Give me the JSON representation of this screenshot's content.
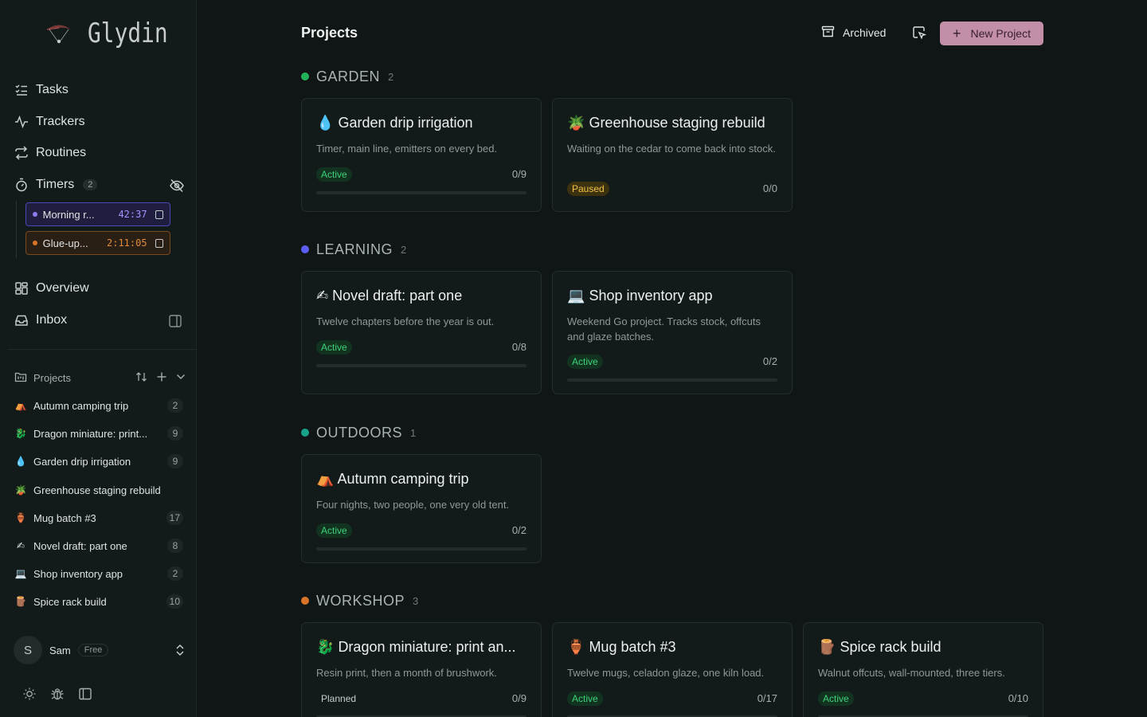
{
  "app": {
    "name": "Glydin"
  },
  "nav": {
    "tasks": "Tasks",
    "trackers": "Trackers",
    "routines": "Routines",
    "timers": "Timers",
    "timers_count": "2",
    "overview": "Overview",
    "inbox": "Inbox"
  },
  "timers": [
    {
      "name": "Morning r...",
      "time": "42:37",
      "color": "#8b7cf0"
    },
    {
      "name": "Glue-up...",
      "time": "2:11:05",
      "color": "#d8742a"
    }
  ],
  "sidebar_projects": {
    "header": "Projects",
    "items": [
      {
        "emoji": "⛺",
        "label": "Autumn camping trip",
        "count": "2"
      },
      {
        "emoji": "🐉",
        "label": "Dragon miniature: print...",
        "count": "9"
      },
      {
        "emoji": "💧",
        "label": "Garden drip irrigation",
        "count": "9"
      },
      {
        "emoji": "🪴",
        "label": "Greenhouse staging rebuild",
        "count": ""
      },
      {
        "emoji": "🏺",
        "label": "Mug batch #3",
        "count": "17"
      },
      {
        "emoji": "✍",
        "label": "Novel draft: part one",
        "count": "8"
      },
      {
        "emoji": "💻",
        "label": "Shop inventory app",
        "count": "2"
      },
      {
        "emoji": "🪵",
        "label": "Spice rack build",
        "count": "10"
      }
    ]
  },
  "user": {
    "initial": "S",
    "name": "Sam",
    "plan": "Free"
  },
  "header": {
    "title": "Projects",
    "archived_label": "Archived",
    "new_project_label": "New Project"
  },
  "groups": [
    {
      "name": "GARDEN",
      "count": "2",
      "color": "#22b35a",
      "cards": [
        {
          "emoji": "💧",
          "title": "Garden drip irrigation",
          "desc": "Timer, main line, emitters on every bed.",
          "status": "Active",
          "progress": "0/9",
          "progress_fraction": 0
        },
        {
          "emoji": "🪴",
          "title": "Greenhouse staging rebuild",
          "desc": "Waiting on the cedar to come back into stock.",
          "status": "Paused",
          "progress": "0/0",
          "progress_fraction": 0
        }
      ]
    },
    {
      "name": "LEARNING",
      "count": "2",
      "color": "#5b5ef0",
      "cards": [
        {
          "emoji": "✍",
          "title": "Novel draft: part one",
          "desc": "Twelve chapters before the year is out.",
          "status": "Active",
          "progress": "0/8",
          "progress_fraction": 0
        },
        {
          "emoji": "💻",
          "title": "Shop inventory app",
          "desc": "Weekend Go project. Tracks stock, offcuts and glaze batches.",
          "status": "Active",
          "progress": "0/2",
          "progress_fraction": 0
        }
      ]
    },
    {
      "name": "OUTDOORS",
      "count": "1",
      "color": "#17a38a",
      "cards": [
        {
          "emoji": "⛺",
          "title": "Autumn camping trip",
          "desc": "Four nights, two people, one very old tent.",
          "status": "Active",
          "progress": "0/2",
          "progress_fraction": 0
        }
      ]
    },
    {
      "name": "WORKSHOP",
      "count": "3",
      "color": "#d8742a",
      "cards": [
        {
          "emoji": "🐉",
          "title": "Dragon miniature: print an...",
          "desc": "Resin print, then a month of brushwork.",
          "status": "Planned",
          "progress": "0/9",
          "progress_fraction": 0
        },
        {
          "emoji": "🏺",
          "title": "Mug batch #3",
          "desc": "Twelve mugs, celadon glaze, one kiln load.",
          "status": "Active",
          "progress": "0/17",
          "progress_fraction": 0
        },
        {
          "emoji": "🪵",
          "title": "Spice rack build",
          "desc": "Walnut offcuts, wall-mounted, three tiers.",
          "status": "Active",
          "progress": "0/10",
          "progress_fraction": 0
        }
      ]
    }
  ]
}
